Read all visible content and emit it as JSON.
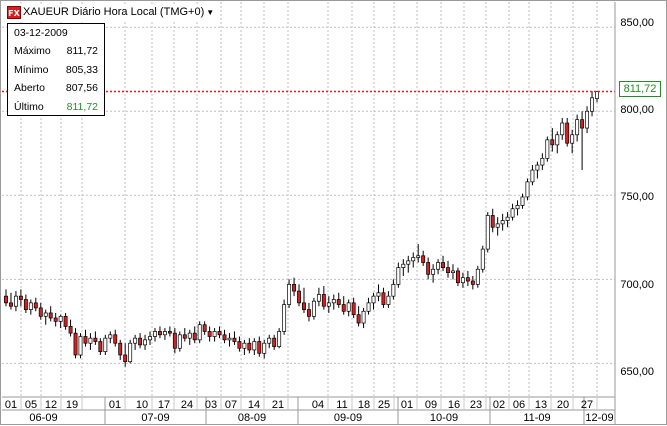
{
  "window": {
    "title": "XAUEUR Diário Hora Local (TMG+0)",
    "logo_text": "FX"
  },
  "info_box": {
    "date": "03-12-2009",
    "rows": [
      {
        "label": "Máximo",
        "value": "811,72"
      },
      {
        "label": "Mínimo",
        "value": "805,33"
      },
      {
        "label": "Aberto",
        "value": "807,56"
      },
      {
        "label": "Último",
        "value": "811,72"
      }
    ]
  },
  "price_axis": {
    "labels": [
      "850,00",
      "800,00",
      "750,00",
      "700,00",
      "650,00"
    ],
    "last_price_tag": "811,72"
  },
  "time_axis": {
    "days": [
      "01",
      "05",
      "12",
      "19",
      "01",
      "10",
      "17",
      "24",
      "03",
      "07",
      "14",
      "21",
      "04",
      "11",
      "18",
      "25",
      "01",
      "09",
      "16",
      "23",
      "02",
      "06",
      "13",
      "20",
      "27"
    ],
    "months": [
      "06-09",
      "07-09",
      "08-09",
      "09-09",
      "10-09",
      "11-09",
      "12-09"
    ]
  },
  "colors": {
    "up_candle": "#ffffff",
    "down_candle": "#d42020",
    "wick": "#000000",
    "grid": "#c0c0c0",
    "last_price_line": "#d42020",
    "last_value": "#2a8a2a"
  },
  "chart_data": {
    "type": "candlestick",
    "symbol": "XAUEUR",
    "ylim": [
      630,
      865
    ],
    "yticks": [
      650,
      700,
      750,
      800,
      850
    ],
    "last_price": 811.72,
    "candles": [
      [
        690,
        694,
        684,
        686
      ],
      [
        686,
        692,
        682,
        684
      ],
      [
        684,
        693,
        681,
        690
      ],
      [
        690,
        694,
        684,
        688
      ],
      [
        688,
        691,
        680,
        682
      ],
      [
        682,
        688,
        679,
        686
      ],
      [
        686,
        689,
        681,
        683
      ],
      [
        683,
        686,
        676,
        678
      ],
      [
        678,
        682,
        673,
        680
      ],
      [
        680,
        684,
        675,
        677
      ],
      [
        677,
        680,
        672,
        675
      ],
      [
        675,
        679,
        671,
        678
      ],
      [
        678,
        680,
        670,
        672
      ],
      [
        672,
        676,
        666,
        668
      ],
      [
        668,
        671,
        653,
        655
      ],
      [
        655,
        668,
        653,
        666
      ],
      [
        666,
        670,
        660,
        662
      ],
      [
        662,
        668,
        658,
        665
      ],
      [
        665,
        669,
        661,
        663
      ],
      [
        663,
        665,
        655,
        657
      ],
      [
        657,
        667,
        655,
        665
      ],
      [
        665,
        669,
        662,
        667
      ],
      [
        667,
        670,
        660,
        662
      ],
      [
        662,
        664,
        652,
        655
      ],
      [
        655,
        662,
        648,
        651
      ],
      [
        651,
        664,
        650,
        662
      ],
      [
        662,
        667,
        658,
        665
      ],
      [
        665,
        668,
        659,
        661
      ],
      [
        661,
        667,
        658,
        664
      ],
      [
        664,
        669,
        661,
        666
      ],
      [
        666,
        671,
        663,
        669
      ],
      [
        669,
        672,
        665,
        667
      ],
      [
        667,
        671,
        664,
        669
      ],
      [
        669,
        672,
        666,
        668
      ],
      [
        668,
        671,
        656,
        659
      ],
      [
        659,
        669,
        657,
        667
      ],
      [
        667,
        671,
        663,
        665
      ],
      [
        665,
        670,
        661,
        668
      ],
      [
        668,
        672,
        662,
        664
      ],
      [
        664,
        675,
        662,
        673
      ],
      [
        673,
        675,
        667,
        669
      ],
      [
        669,
        672,
        663,
        666
      ],
      [
        666,
        671,
        663,
        669
      ],
      [
        669,
        672,
        665,
        667
      ],
      [
        667,
        670,
        662,
        664
      ],
      [
        664,
        668,
        660,
        665
      ],
      [
        665,
        669,
        661,
        663
      ],
      [
        663,
        666,
        657,
        659
      ],
      [
        659,
        664,
        655,
        662
      ],
      [
        662,
        665,
        656,
        658
      ],
      [
        658,
        665,
        655,
        663
      ],
      [
        663,
        666,
        654,
        656
      ],
      [
        656,
        664,
        653,
        662
      ],
      [
        662,
        667,
        659,
        665
      ],
      [
        665,
        667,
        658,
        660
      ],
      [
        660,
        671,
        659,
        669
      ],
      [
        669,
        688,
        667,
        685
      ],
      [
        685,
        700,
        683,
        697
      ],
      [
        697,
        701,
        690,
        693
      ],
      [
        693,
        697,
        684,
        686
      ],
      [
        686,
        695,
        680,
        682
      ],
      [
        682,
        686,
        675,
        678
      ],
      [
        678,
        689,
        676,
        687
      ],
      [
        687,
        695,
        684,
        691
      ],
      [
        691,
        696,
        682,
        684
      ],
      [
        684,
        690,
        680,
        686
      ],
      [
        686,
        691,
        682,
        688
      ],
      [
        688,
        692,
        683,
        685
      ],
      [
        685,
        690,
        679,
        681
      ],
      [
        681,
        688,
        678,
        686
      ],
      [
        686,
        689,
        677,
        679
      ],
      [
        679,
        684,
        672,
        674
      ],
      [
        674,
        683,
        671,
        681
      ],
      [
        681,
        689,
        679,
        686
      ],
      [
        686,
        692,
        682,
        690
      ],
      [
        690,
        697,
        687,
        692
      ],
      [
        692,
        695,
        683,
        685
      ],
      [
        685,
        693,
        683,
        690
      ],
      [
        690,
        700,
        688,
        697
      ],
      [
        697,
        710,
        695,
        707
      ],
      [
        707,
        712,
        702,
        709
      ],
      [
        709,
        714,
        704,
        711
      ],
      [
        711,
        716,
        707,
        713
      ],
      [
        713,
        721,
        710,
        714
      ],
      [
        714,
        717,
        708,
        710
      ],
      [
        710,
        713,
        700,
        703
      ],
      [
        703,
        709,
        698,
        706
      ],
      [
        706,
        712,
        703,
        710
      ],
      [
        710,
        714,
        705,
        707
      ],
      [
        707,
        711,
        701,
        704
      ],
      [
        704,
        709,
        700,
        705
      ],
      [
        705,
        707,
        696,
        698
      ],
      [
        698,
        704,
        695,
        701
      ],
      [
        701,
        705,
        696,
        699
      ],
      [
        699,
        702,
        694,
        697
      ],
      [
        697,
        708,
        695,
        706
      ],
      [
        706,
        720,
        704,
        718
      ],
      [
        718,
        740,
        716,
        738
      ],
      [
        738,
        742,
        728,
        731
      ],
      [
        731,
        737,
        726,
        733
      ],
      [
        733,
        739,
        729,
        735
      ],
      [
        735,
        740,
        731,
        737
      ],
      [
        737,
        745,
        735,
        742
      ],
      [
        742,
        747,
        738,
        744
      ],
      [
        744,
        751,
        742,
        749
      ],
      [
        749,
        760,
        747,
        758
      ],
      [
        758,
        768,
        756,
        765
      ],
      [
        765,
        770,
        760,
        768
      ],
      [
        768,
        775,
        765,
        772
      ],
      [
        772,
        785,
        770,
        783
      ],
      [
        783,
        790,
        776,
        780
      ],
      [
        780,
        788,
        775,
        786
      ],
      [
        786,
        796,
        783,
        793
      ],
      [
        793,
        796,
        779,
        781
      ],
      [
        781,
        789,
        775,
        786
      ],
      [
        786,
        798,
        782,
        795
      ],
      [
        795,
        800,
        765,
        790
      ],
      [
        790,
        803,
        787,
        800
      ],
      [
        800,
        812,
        797,
        808
      ],
      [
        807.56,
        811.72,
        805.33,
        811.72
      ]
    ]
  }
}
